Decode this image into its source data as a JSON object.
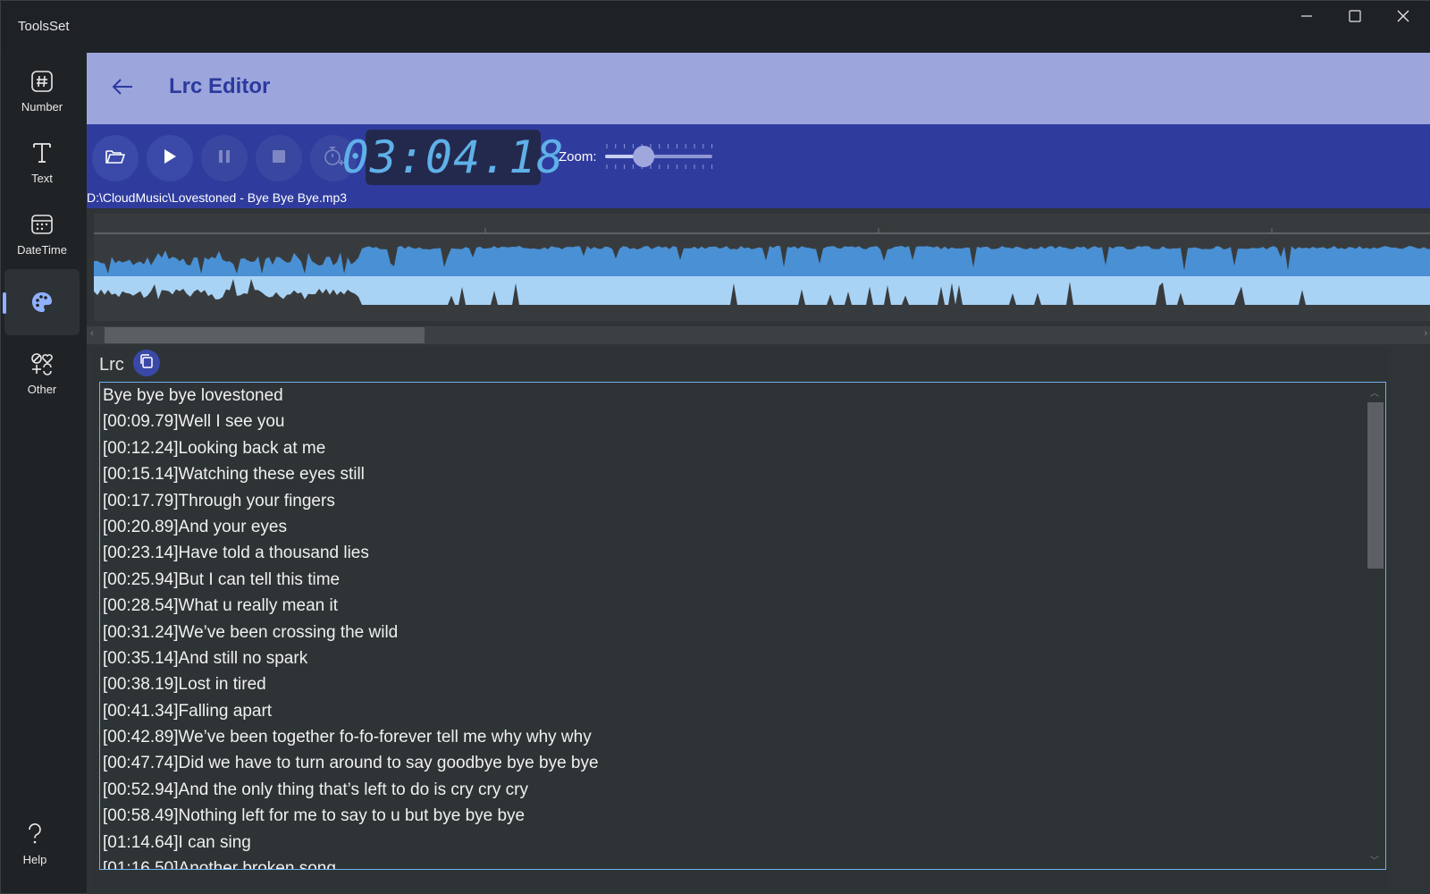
{
  "app": {
    "title": "ToolsSet"
  },
  "window_controls": {
    "minimize": "minimize-icon",
    "maximize": "maximize-icon",
    "close": "close-icon"
  },
  "sidebar": {
    "items": [
      {
        "label": "Number",
        "icon": "hash-icon"
      },
      {
        "label": "Text",
        "icon": "text-icon"
      },
      {
        "label": "DateTime",
        "icon": "calendar-icon"
      },
      {
        "label": "",
        "icon": "palette-icon",
        "active": true
      },
      {
        "label": "Other",
        "icon": "shapes-icon"
      }
    ],
    "help": {
      "label": "Help",
      "icon": "question-icon"
    }
  },
  "header": {
    "title": "Lrc Editor",
    "back_icon": "back-arrow-icon"
  },
  "toolbar": {
    "time_display": "03:04.18",
    "zoom_label": "Zoom:",
    "zoom_level": 0.36,
    "file_path": "D:\\CloudMusic\\Lovestoned - Bye Bye Bye.mp3"
  },
  "colors": {
    "header_bg": "#9ca5dc",
    "toolbar_bg": "#2f3c9e",
    "accent": "#2b3a9e",
    "wave_top": "#4a90d4",
    "wave_bottom": "#a9d3f5",
    "lcd_text": "#5fb0e8"
  },
  "lrc": {
    "label": "Lrc",
    "lines": [
      "Bye bye bye lovestoned",
      "[00:09.79]Well I see you",
      "[00:12.24]Looking back at me",
      "[00:15.14]Watching these eyes still",
      "[00:17.79]Through your fingers",
      "[00:20.89]And your eyes",
      "[00:23.14]Have told a thousand lies",
      "[00:25.94]But I can tell this time",
      "[00:28.54]What u really mean it",
      "[00:31.24]We’ve been crossing the wild",
      "[00:35.14]And still no spark",
      "[00:38.19]Lost in tired",
      "[00:41.34]Falling apart",
      "[00:42.89]We’ve been together fo-fo-forever tell me why why why",
      "[00:47.74]Did we have to turn around to say goodbye bye bye bye",
      "[00:52.94]And the only thing that’s left to do is cry cry cry",
      "[00:58.49]Nothing left for me to say to u but bye bye bye",
      "[01:14.64]I can sing",
      "[01:16.50]Another broken song"
    ]
  }
}
